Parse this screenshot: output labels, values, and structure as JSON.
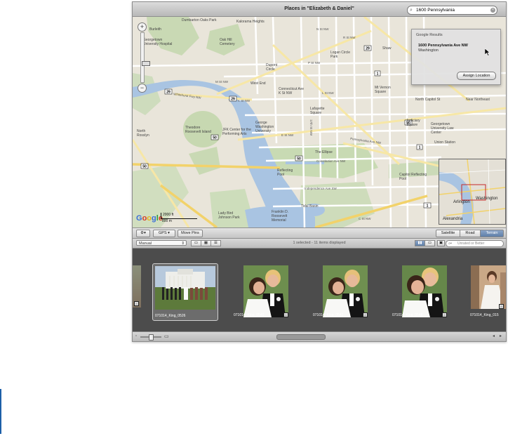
{
  "window": {
    "title": "Places in \"Elizabeth & Daniel\""
  },
  "search": {
    "value": "1600 Pennsylvania",
    "clear_icon": "clear-icon",
    "icon": "magnifier-icon"
  },
  "results": {
    "header": "Google Results",
    "address": "1600 Pennsylvania Ave NW",
    "city": "Washington",
    "assign_label": "Assign Location"
  },
  "map": {
    "zoom_in": "+",
    "zoom_out": "−",
    "google": "Google",
    "scale_ft": "2000 ft",
    "scale_m": "800 m",
    "credit": "Map data ©2009",
    "labels": {
      "burleith": "Burleith",
      "georgetown_hospital": "Georgetown University Hospital",
      "dumbarton": "Dumbarton Oaks Park",
      "oak_hill": "Oak Hill Cemetery",
      "kalorama": "Kalorama Heights",
      "dupont": "Dupont Circle",
      "logan": "Logan Circle Park",
      "shaw": "Shaw",
      "westend": "West End",
      "ctave": "Connecticut Ave K St NW",
      "mtvernon": "Mt Vernon Square",
      "northcapitol": "North Capitol St",
      "nearnortheast": "Near Northeast",
      "lafayette": "Lafayette Square",
      "judiciary": "Judiciary Square",
      "georgelaw": "Georgetown University Law Center",
      "union_station": "Union Station",
      "rosslyn": "North Rosslyn",
      "theodore": "Theodore Roosevelt Island",
      "jfk": "JFK Center for the Performing Arts",
      "george_wash": "George Washington University",
      "ellipse": "The Ellipse",
      "reflecting": "Reflecting Pool",
      "tidal": "Tidal Basin",
      "fdr": "Franklin D. Roosevelt Memorial",
      "ladybird": "Lady Bird Johnson Park",
      "capitol": "Capitol Reflecting Pool",
      "independence": "Independence Ave SW",
      "constitution": "Constitution Ave NW",
      "pennsylvania": "Pennsylvania Ave NW",
      "kstnw": "K St NW",
      "mstnw": "M St NW",
      "pstnw": "P St NW",
      "lstnw": "L St NW",
      "estnw": "E St NW",
      "whitehurst": "Whitehurst Fwy NW",
      "nstnw": "N St NW",
      "17th": "17th St NW",
      "rstnw": "R St NW",
      "cstnw": "C St NW",
      "rock_creek": "Rock Creek Park",
      "arlington": "Arlington",
      "washington": "Washington",
      "alexandria": "Alexandria",
      "shields": [
        "29",
        "50",
        "1",
        "66",
        "395",
        "50",
        "29",
        "1",
        "1",
        "50",
        "395"
      ]
    }
  },
  "map_toolbar": {
    "gear_icon": "gear-icon",
    "gps_label": "GPS",
    "move_pins_label": "Move Pins",
    "modes": [
      "Satellite",
      "Road",
      "Terrain"
    ],
    "active_mode": "Terrain"
  },
  "browse_bar": {
    "sort_value": "Manual",
    "status": "1 selected - 11 items displayed",
    "filter_placeholder": "Unrated or Better",
    "view_icons": [
      "filmstrip-view-icon",
      "grid-view-icon",
      "list-view-icon"
    ]
  },
  "filmstrip": {
    "items": [
      {
        "name": "071014_King_0526",
        "selected": true
      },
      {
        "name": "071014_King_0540",
        "selected": false
      },
      {
        "name": "071014_King_0541",
        "selected": false
      },
      {
        "name": "071014_King_0548",
        "selected": false
      },
      {
        "name": "071014_King_015",
        "selected": false
      }
    ]
  }
}
